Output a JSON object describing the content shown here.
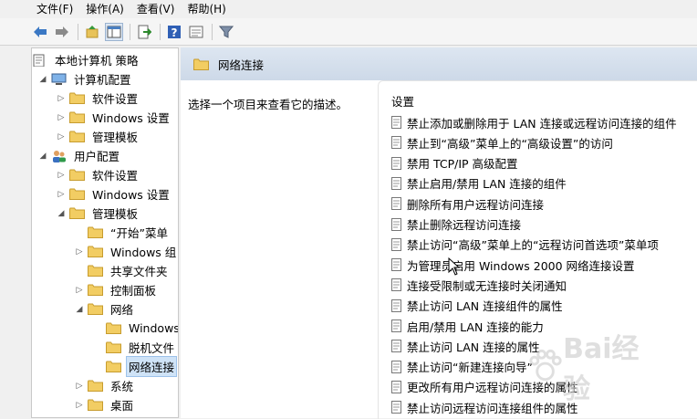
{
  "menubar": {
    "items": [
      "文件(F)",
      "操作(A)",
      "查看(V)",
      "帮助(H)"
    ]
  },
  "toolbar": {
    "buttons": [
      "back-arrow-icon",
      "forward-arrow-icon",
      "up-folder-icon",
      "show-hide-tree-icon",
      "export-list-icon",
      "help-icon",
      "properties-icon",
      "filter-icon"
    ]
  },
  "tree": {
    "items": [
      {
        "label": "本地计算机 策略",
        "icon": "policy-icon",
        "level": 0,
        "arrow": ""
      },
      {
        "label": "计算机配置",
        "icon": "computer-icon",
        "level": 1,
        "arrow": "expanded"
      },
      {
        "label": "软件设置",
        "icon": "folder-icon",
        "level": 2,
        "arrow": "collapsed"
      },
      {
        "label": "Windows 设置",
        "icon": "folder-icon",
        "level": 2,
        "arrow": "collapsed"
      },
      {
        "label": "管理模板",
        "icon": "folder-icon",
        "level": 2,
        "arrow": "collapsed"
      },
      {
        "label": "用户配置",
        "icon": "user-icon",
        "level": 1,
        "arrow": "expanded"
      },
      {
        "label": "软件设置",
        "icon": "folder-icon",
        "level": 2,
        "arrow": "collapsed"
      },
      {
        "label": "Windows 设置",
        "icon": "folder-icon",
        "level": 2,
        "arrow": "collapsed"
      },
      {
        "label": "管理模板",
        "icon": "folder-icon",
        "level": 2,
        "arrow": "expanded"
      },
      {
        "label": "“开始”菜单",
        "icon": "folder-icon",
        "level": 3,
        "arrow": ""
      },
      {
        "label": "Windows 组",
        "icon": "folder-icon",
        "level": 3,
        "arrow": "collapsed"
      },
      {
        "label": "共享文件夹",
        "icon": "folder-icon",
        "level": 3,
        "arrow": ""
      },
      {
        "label": "控制面板",
        "icon": "folder-icon",
        "level": 3,
        "arrow": "collapsed"
      },
      {
        "label": "网络",
        "icon": "folder-icon",
        "level": 3,
        "arrow": "expanded"
      },
      {
        "label": "Windows",
        "icon": "folder-icon",
        "level": 4,
        "arrow": ""
      },
      {
        "label": "脱机文件",
        "icon": "folder-icon",
        "level": 4,
        "arrow": ""
      },
      {
        "label": "网络连接",
        "icon": "folder-icon",
        "level": 4,
        "arrow": "",
        "selected": true
      },
      {
        "label": "系统",
        "icon": "folder-icon",
        "level": 3,
        "arrow": "collapsed"
      },
      {
        "label": "桌面",
        "icon": "folder-icon",
        "level": 3,
        "arrow": "collapsed"
      }
    ]
  },
  "right": {
    "title": "网络连接",
    "description": "选择一个项目来查看它的描述。",
    "column_header": "设置",
    "settings": [
      "禁止添加或删除用于 LAN 连接或远程访问连接的组件",
      "禁止到“高级”菜单上的“高级设置”的访问",
      "禁用 TCP/IP 高级配置",
      "禁止启用/禁用 LAN 连接的组件",
      "删除所有用户远程访问连接",
      "禁止删除远程访问连接",
      "禁止访问“高级”菜单上的“远程访问首选项”菜单项",
      "为管理员启用 Windows 2000 网络连接设置",
      "连接受限制或无连接时关闭通知",
      "禁止访问 LAN 连接组件的属性",
      "启用/禁用 LAN 连接的能力",
      "禁止访问 LAN 连接的属性",
      "禁止访问“新建连接向导”",
      "更改所有用户远程访问连接的属性",
      "禁止访问远程访问连接组件的属性"
    ]
  },
  "watermark": {
    "text": "Bai经验"
  }
}
